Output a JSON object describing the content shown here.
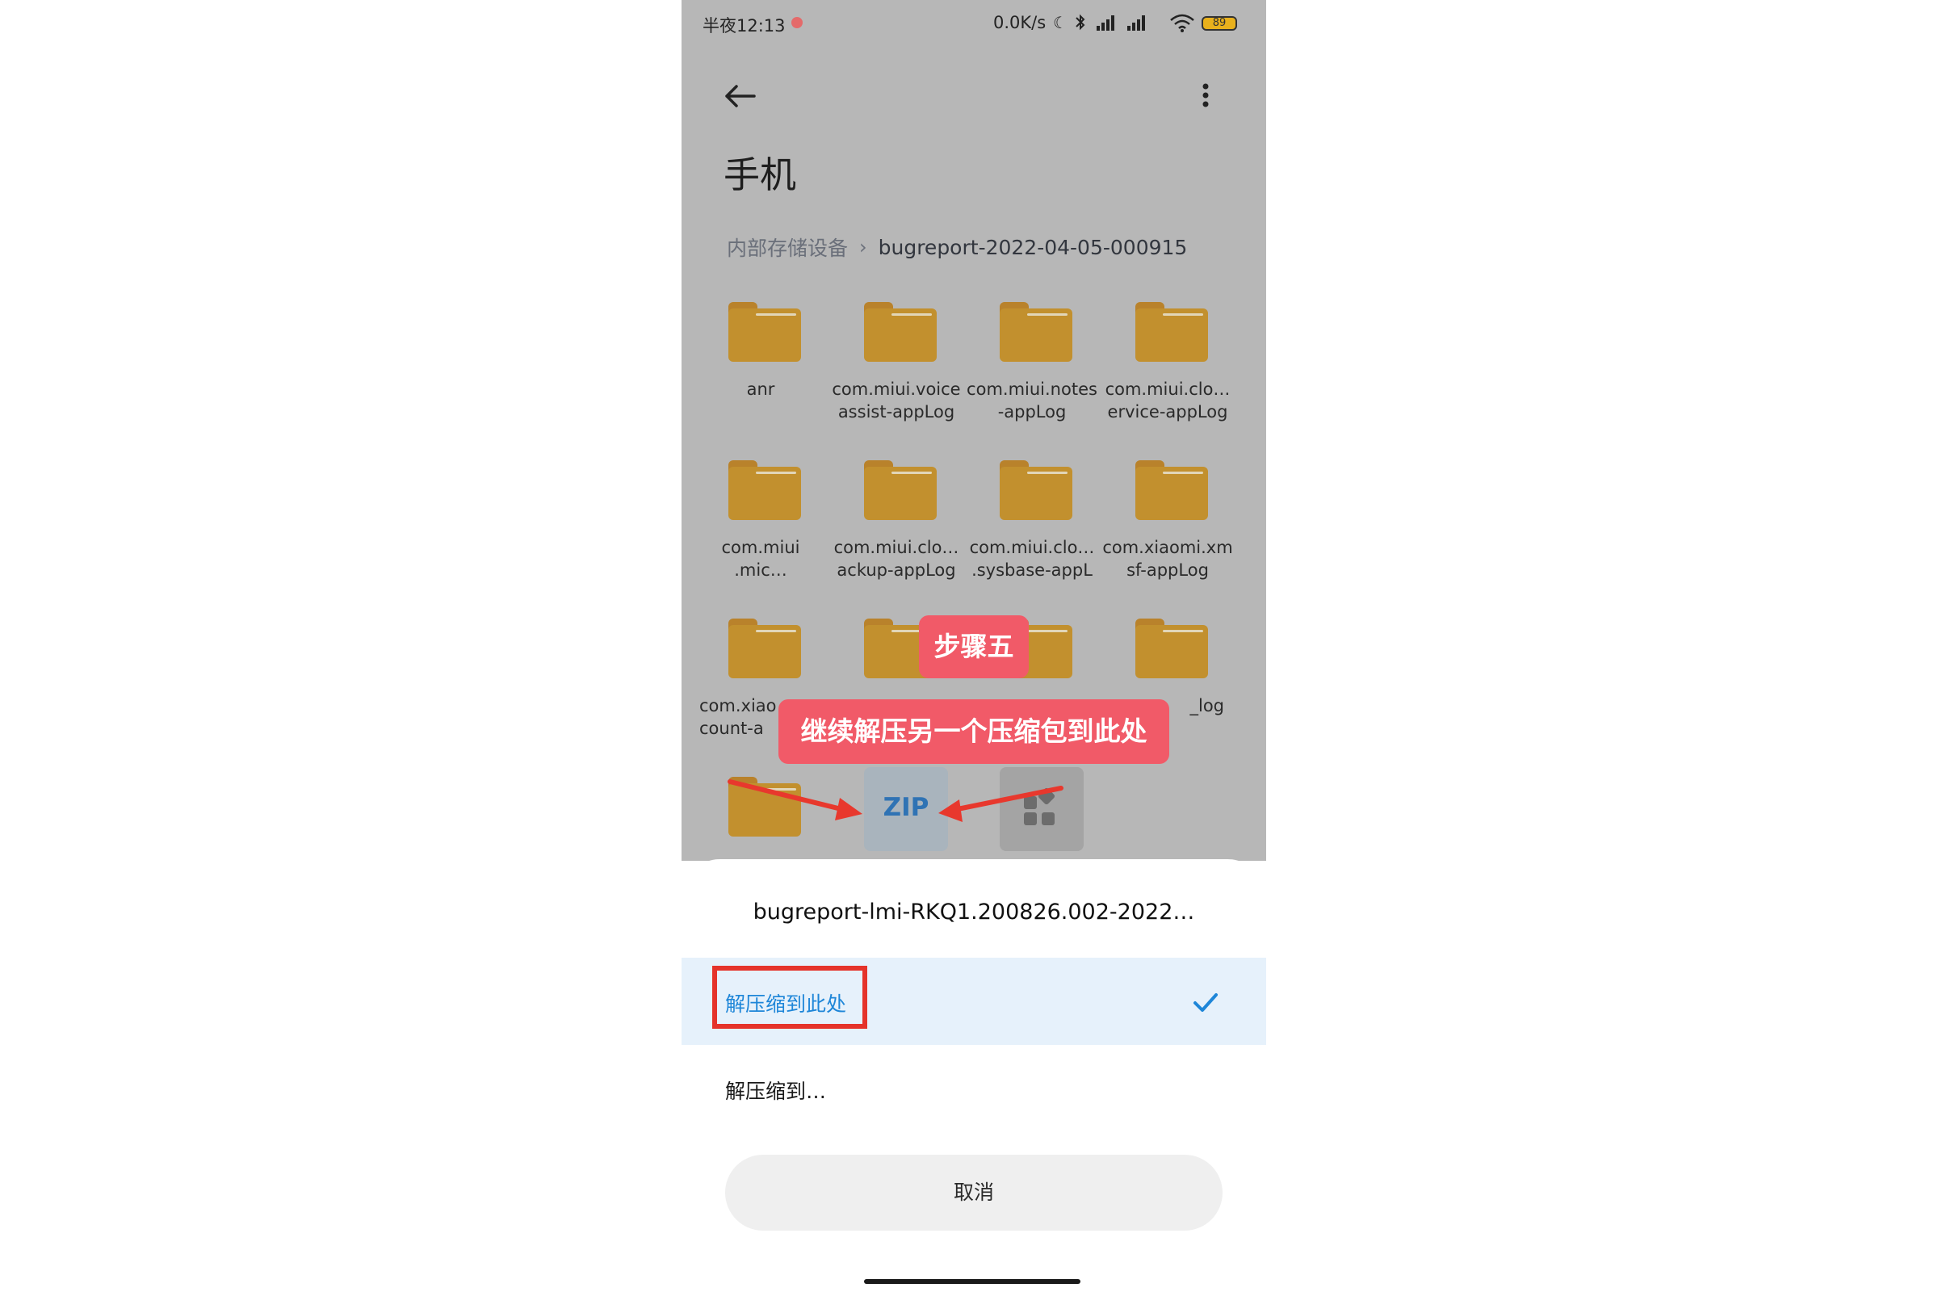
{
  "status_bar": {
    "time": "半夜12:13",
    "speed": "0.0K/s",
    "battery": "89"
  },
  "header": {
    "title": "手机"
  },
  "breadcrumb": {
    "root": "内部存储设备",
    "current": "bugreport-2022-04-05-000915"
  },
  "folders": [
    "anr",
    "com.miui.voice\nassist-appLog",
    "com.miui.notes\n-appLog",
    "com.miui.clo…\nervice-appLog",
    "com.miui\n.mic…",
    "com.miui.clo…\nackup-appLog",
    "com.miui.clo…\n.sysbase-appL",
    "com.xiaomi.xm\nsf-appLog",
    "com.xiao\ncount-a",
    "",
    "",
    "_log"
  ],
  "zip_label": "ZIP",
  "annotations": {
    "step": "步骤五",
    "description": "继续解压另一个压缩包到此处"
  },
  "sheet": {
    "title": "bugreport-lmi-RKQ1.200826.002-2022…",
    "option_selected": "解压缩到此处",
    "option_other": "解压缩到…",
    "cancel": "取消"
  },
  "colors": {
    "accent_blue": "#1e86d8",
    "annotation_red": "#f15a68",
    "highlight_box": "#e5332a",
    "folder": "#c2902e"
  }
}
